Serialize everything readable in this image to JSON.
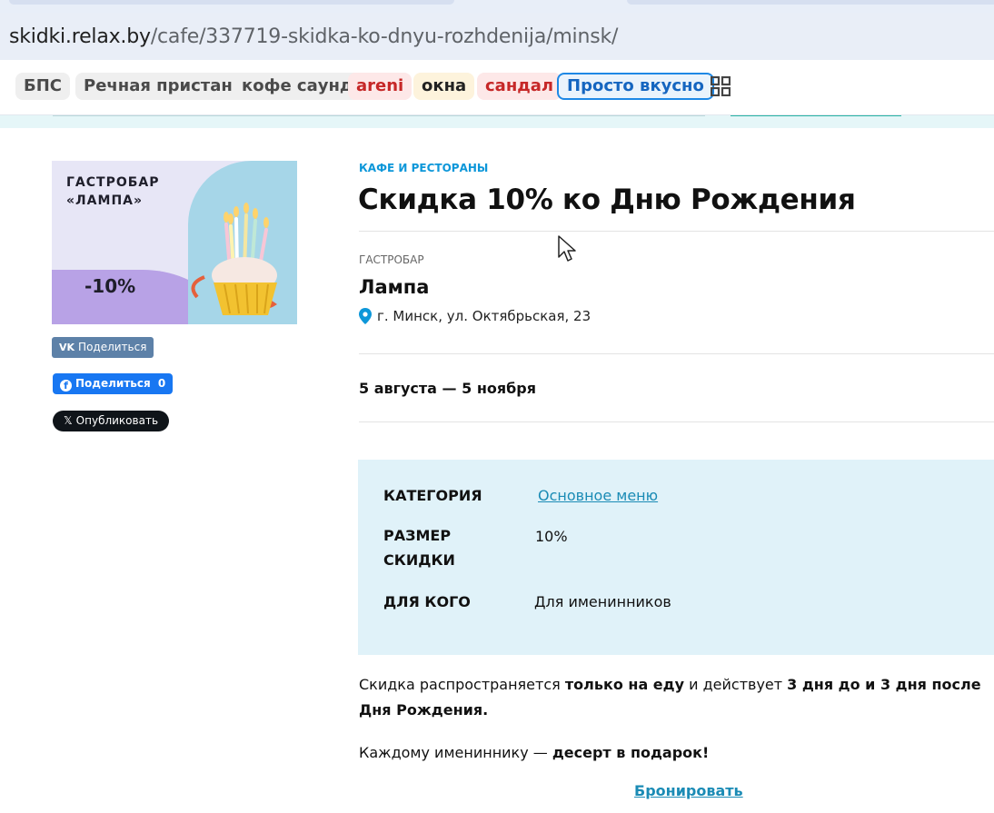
{
  "browser": {
    "url_host": "skidki.relax.by",
    "url_path": "/cafe/337719-skidka-ko-dnyu-rozhdenija/minsk/"
  },
  "tags": [
    {
      "label": "БПС",
      "style": "grey"
    },
    {
      "label": "Речная пристань",
      "style": "grey"
    },
    {
      "label": "кофе саунд",
      "style": "grey"
    },
    {
      "label": "areni",
      "style": "red"
    },
    {
      "label": "окна",
      "style": "yellow"
    },
    {
      "label": "сандал",
      "style": "red"
    },
    {
      "label": "Просто вкусно",
      "style": "outline"
    }
  ],
  "banner": {
    "title_line1": "ГАСТРОБАР",
    "title_line2": "«ЛАМПА»",
    "discount": "-10%"
  },
  "share": {
    "vk_label": "Поделиться",
    "fb_label": "Поделиться",
    "fb_count": "0",
    "x_label": "Опубликовать"
  },
  "offer": {
    "category": "КАФЕ И РЕСТОРАНЫ",
    "title": "Скидка 10% ко Дню Рождения",
    "venue_type": "ГАСТРОБАР",
    "venue_name": "Лампа",
    "address": "г. Минск, ул. Октябрьская, 23",
    "dates": "5 августа — 5 ноября"
  },
  "info": {
    "category_key": "КАТЕГОРИЯ",
    "category_value": "Основное меню",
    "size_key_line1": "РАЗМЕР",
    "size_key_line2": "СКИДКИ",
    "size_value": "10%",
    "for_key": "ДЛЯ КОГО",
    "for_value": "Для именинников"
  },
  "description": {
    "p1_a": "Скидка распространяется ",
    "p1_b": "только на еду",
    "p1_c": " и действует ",
    "p1_d": "3 дня до и 3 дня после Дня Рождения.",
    "p2_a": "Каждому имениннику — ",
    "p2_b": "десерт в подарок!"
  },
  "actions": {
    "book_label": "Бронировать"
  },
  "colors": {
    "accent": "#0d97d9",
    "link": "#1a8bb5",
    "info_bg": "#e0f2f9"
  }
}
